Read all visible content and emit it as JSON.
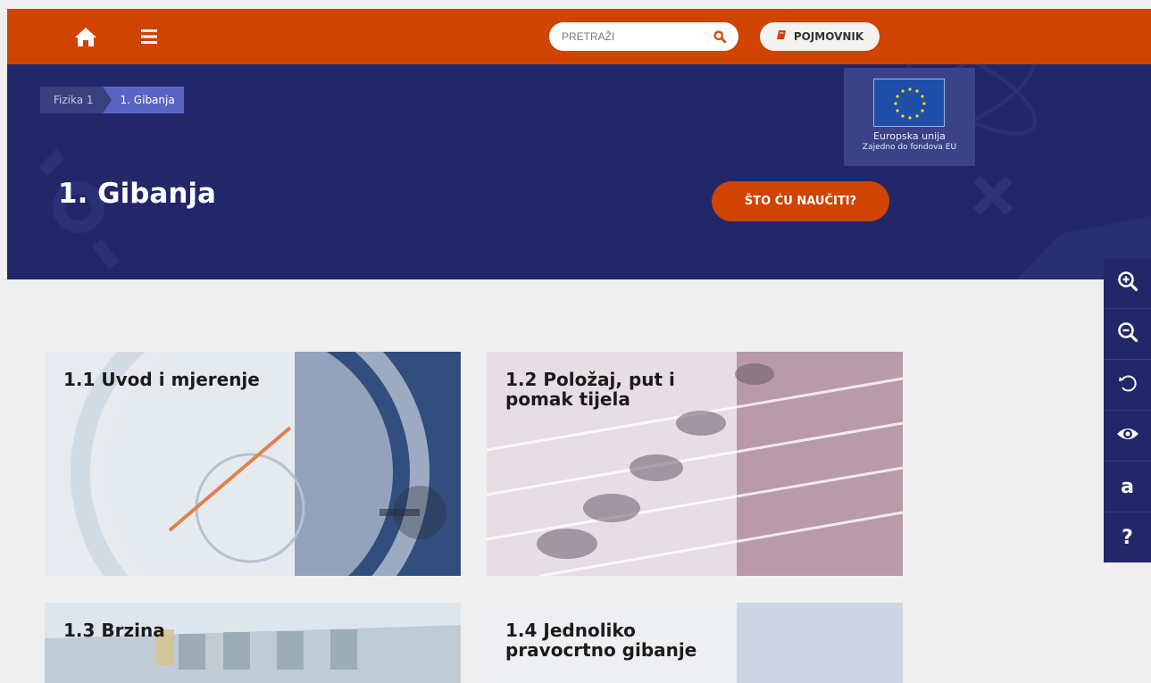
{
  "topbar": {
    "search_placeholder": "PRETRAŽI",
    "glossary_label": "POJMOVNIK"
  },
  "breadcrumb": {
    "items": [
      "Fizika 1",
      "1. Gibanja"
    ]
  },
  "hero": {
    "title": "1. Gibanja",
    "learn_button": "ŠTO ĆU NAUČITI?"
  },
  "eu_badge": {
    "line1": "Europska unija",
    "line2": "Zajedno do fondova EU"
  },
  "tools": [
    {
      "icon": "zoom-in-icon"
    },
    {
      "icon": "zoom-out-icon"
    },
    {
      "icon": "reset-icon"
    },
    {
      "icon": "eye-icon"
    },
    {
      "icon": "font-icon",
      "text": "a"
    },
    {
      "icon": "help-icon",
      "text": "?"
    }
  ],
  "cards": [
    {
      "title": "1.1 Uvod i mjerenje"
    },
    {
      "title": "1.2 Položaj, put i pomak tijela"
    },
    {
      "title": "1.3 Brzina"
    },
    {
      "title": "1.4 Jednoliko pravocrtno gibanje"
    }
  ],
  "colors": {
    "accent": "#d04300",
    "hero_bg": "#22276a",
    "page_bg": "#efefef"
  }
}
